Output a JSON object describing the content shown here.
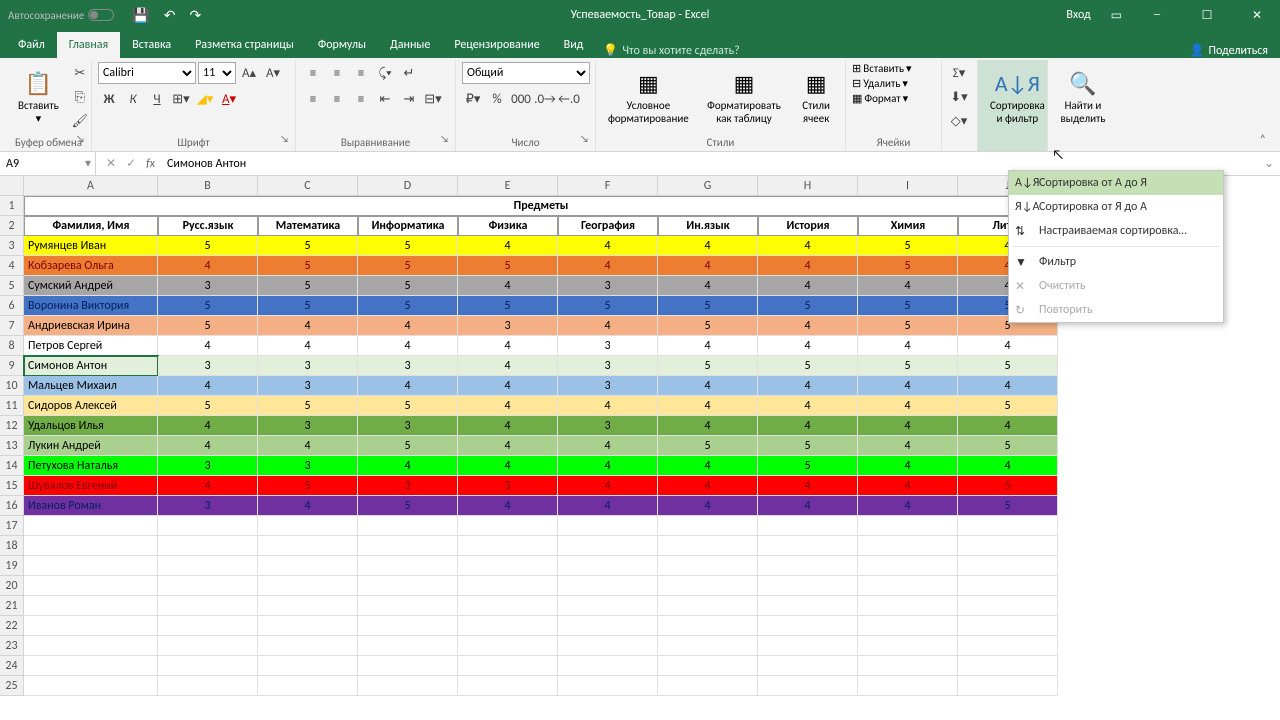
{
  "titlebar": {
    "autosave": "Автосохранение",
    "title": "Успеваемость_Товар - Excel",
    "login": "Вход"
  },
  "tabs": {
    "file": "Файл",
    "home": "Главная",
    "insert": "Вставка",
    "layout": "Разметка страницы",
    "formulas": "Формулы",
    "data": "Данные",
    "review": "Рецензирование",
    "view": "Вид",
    "tell": "Что вы хотите сделать?",
    "share": "Поделиться"
  },
  "ribbon": {
    "paste": "Вставить",
    "clipboard": "Буфер обмена",
    "font": "Шрифт",
    "fontname": "Calibri",
    "fontsize": "11",
    "alignment": "Выравнивание",
    "number": "Число",
    "numfmt": "Общий",
    "condfmt": "Условное форматирование",
    "fmttable": "Форматировать как таблицу",
    "cellstyles": "Стили ячеек",
    "styles": "Стили",
    "insert": "Вставить",
    "delete": "Удалить",
    "format": "Формат",
    "cells": "Ячейки",
    "sortfilter": "Сортировка и фильтр",
    "findsel": "Найти и выделить"
  },
  "namebox": {
    "ref": "A9",
    "formula": "Симонов Антон"
  },
  "menu": {
    "sortAZ": "Сортировка от А до Я",
    "sortZA": "Сортировка от Я до А",
    "custom": "Настраиваемая сортировка…",
    "filter": "Фильтр",
    "clear": "Очистить",
    "reapply": "Повторить"
  },
  "headers": {
    "subjects": "Предметы",
    "name": "Фамилия, Имя",
    "cols": [
      "Русс.язык",
      "Математика",
      "Информатика",
      "Физика",
      "География",
      "Ин.язык",
      "История",
      "Химия",
      "Литер"
    ]
  },
  "rows": [
    {
      "name": "Румянцев Иван",
      "v": [
        5,
        5,
        5,
        4,
        4,
        4,
        4,
        5,
        4
      ],
      "bg": "#ffff00"
    },
    {
      "name": "Кобзарева Ольга",
      "v": [
        4,
        5,
        5,
        5,
        4,
        4,
        4,
        5,
        4
      ],
      "bg": "#ed7d31",
      "fg": "#7c0000"
    },
    {
      "name": "Сумский Андрей",
      "v": [
        3,
        5,
        5,
        4,
        3,
        4,
        4,
        4,
        4
      ],
      "bg": "#a6a6a6"
    },
    {
      "name": "Воронина Виктория",
      "v": [
        5,
        5,
        5,
        5,
        5,
        5,
        5,
        5,
        5
      ],
      "bg": "#4472c4",
      "fg": "#002060"
    },
    {
      "name": "Андриевская Ирина",
      "v": [
        5,
        4,
        4,
        3,
        4,
        5,
        4,
        5,
        5
      ],
      "bg": "#f4b084"
    },
    {
      "name": "Петров Сергей",
      "v": [
        4,
        4,
        4,
        4,
        3,
        4,
        4,
        4,
        4
      ],
      "bg": "#ffffff"
    },
    {
      "name": "Симонов Антон",
      "v": [
        3,
        3,
        3,
        4,
        3,
        5,
        5,
        5,
        5
      ],
      "bg": "#e2efda",
      "sel": true
    },
    {
      "name": "Мальцев Михаил",
      "v": [
        4,
        3,
        4,
        4,
        3,
        4,
        4,
        4,
        4
      ],
      "bg": "#9bc2e6"
    },
    {
      "name": "Сидоров Алексей",
      "v": [
        5,
        5,
        5,
        4,
        4,
        4,
        4,
        4,
        5
      ],
      "bg": "#ffe699"
    },
    {
      "name": "Удальцов Илья",
      "v": [
        4,
        3,
        3,
        4,
        3,
        4,
        4,
        4,
        4
      ],
      "bg": "#70ad47"
    },
    {
      "name": "Лукин Андрей",
      "v": [
        4,
        4,
        5,
        4,
        4,
        5,
        5,
        4,
        5
      ],
      "bg": "#a9d08e"
    },
    {
      "name": "Петухова Наталья",
      "v": [
        3,
        3,
        4,
        4,
        4,
        4,
        5,
        4,
        4
      ],
      "bg": "#00ff00"
    },
    {
      "name": "Шувалов Евгений",
      "v": [
        4,
        5,
        3,
        3,
        4,
        4,
        4,
        4,
        5
      ],
      "bg": "#ff0000",
      "fg": "#7c0000"
    },
    {
      "name": "Иванов Роман",
      "v": [
        3,
        4,
        5,
        4,
        4,
        4,
        4,
        4,
        5
      ],
      "bg": "#7030a0",
      "fg": "#002060"
    }
  ]
}
